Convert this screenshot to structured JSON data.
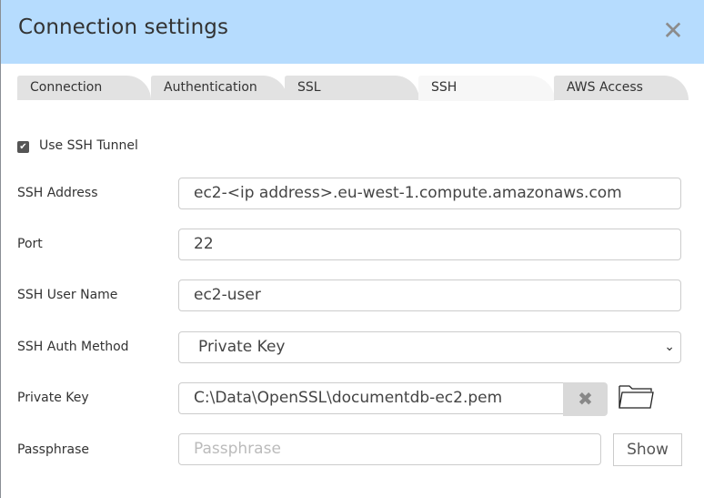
{
  "dialog": {
    "title": "Connection settings",
    "close_icon": "close-icon"
  },
  "tabs": [
    {
      "label": "Connection",
      "active": false
    },
    {
      "label": "Authentication",
      "active": false
    },
    {
      "label": "SSL",
      "active": false
    },
    {
      "label": "SSH",
      "active": true
    },
    {
      "label": "AWS Access",
      "active": false
    }
  ],
  "ssh": {
    "use_tunnel": {
      "label": "Use SSH Tunnel",
      "checked": true
    },
    "address": {
      "label": "SSH Address",
      "value": "ec2-<ip address>.eu-west-1.compute.amazonaws.com"
    },
    "port": {
      "label": "Port",
      "value": "22"
    },
    "user": {
      "label": "SSH User Name",
      "value": "ec2-user"
    },
    "auth_method": {
      "label": "SSH Auth Method",
      "value": "Private Key"
    },
    "private_key": {
      "label": "Private Key",
      "value": "C:\\Data\\OpenSSL\\documentdb-ec2.pem",
      "clear_icon": "clear-icon",
      "browse_icon": "folder-icon"
    },
    "passphrase": {
      "label": "Passphrase",
      "placeholder": "Passphrase",
      "value": "",
      "show_label": "Show"
    }
  }
}
